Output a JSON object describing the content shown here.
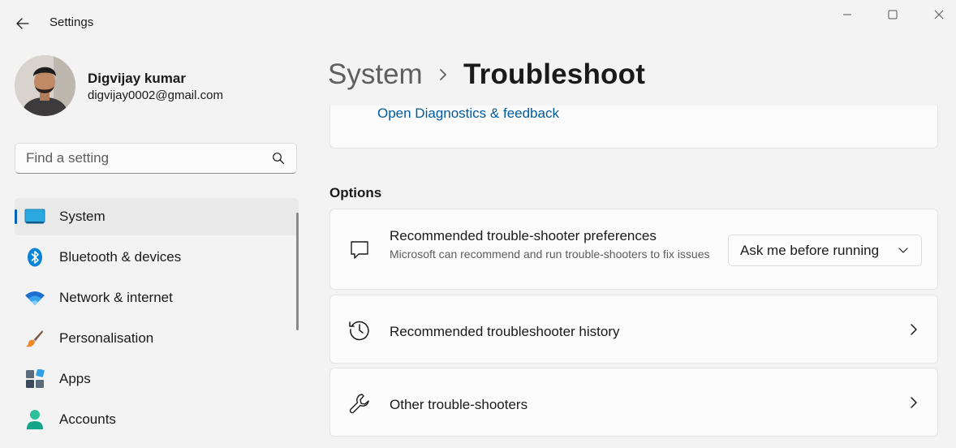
{
  "window": {
    "title": "Settings"
  },
  "profile": {
    "name": "Digvijay kumar",
    "email": "digvijay0002@gmail.com"
  },
  "search": {
    "placeholder": "Find a setting",
    "value": ""
  },
  "sidebar": {
    "items": [
      {
        "label": "System",
        "icon": "system-icon",
        "active": true
      },
      {
        "label": "Bluetooth & devices",
        "icon": "bluetooth-icon",
        "active": false
      },
      {
        "label": "Network & internet",
        "icon": "wifi-icon",
        "active": false
      },
      {
        "label": "Personalisation",
        "icon": "paintbrush-icon",
        "active": false
      },
      {
        "label": "Apps",
        "icon": "apps-icon",
        "active": false
      },
      {
        "label": "Accounts",
        "icon": "accounts-icon",
        "active": false
      }
    ]
  },
  "breadcrumb": {
    "parent": "System",
    "current": "Troubleshoot"
  },
  "diagnostics": {
    "link_label": "Open Diagnostics & feedback"
  },
  "options": {
    "section_title": "Options",
    "preferences": {
      "title": "Recommended trouble-shooter preferences",
      "description": "Microsoft can recommend and run trouble-shooters to fix issues",
      "icon": "feedback-chat-icon",
      "dropdown_value": "Ask me before running"
    },
    "history": {
      "title": "Recommended troubleshooter history",
      "icon": "history-icon"
    },
    "other": {
      "title": "Other trouble-shooters",
      "icon": "wrench-icon"
    }
  },
  "colors": {
    "accent": "#005fb8",
    "link": "#005a9e",
    "background": "#f3f3f3",
    "card": "#fbfbfb"
  }
}
